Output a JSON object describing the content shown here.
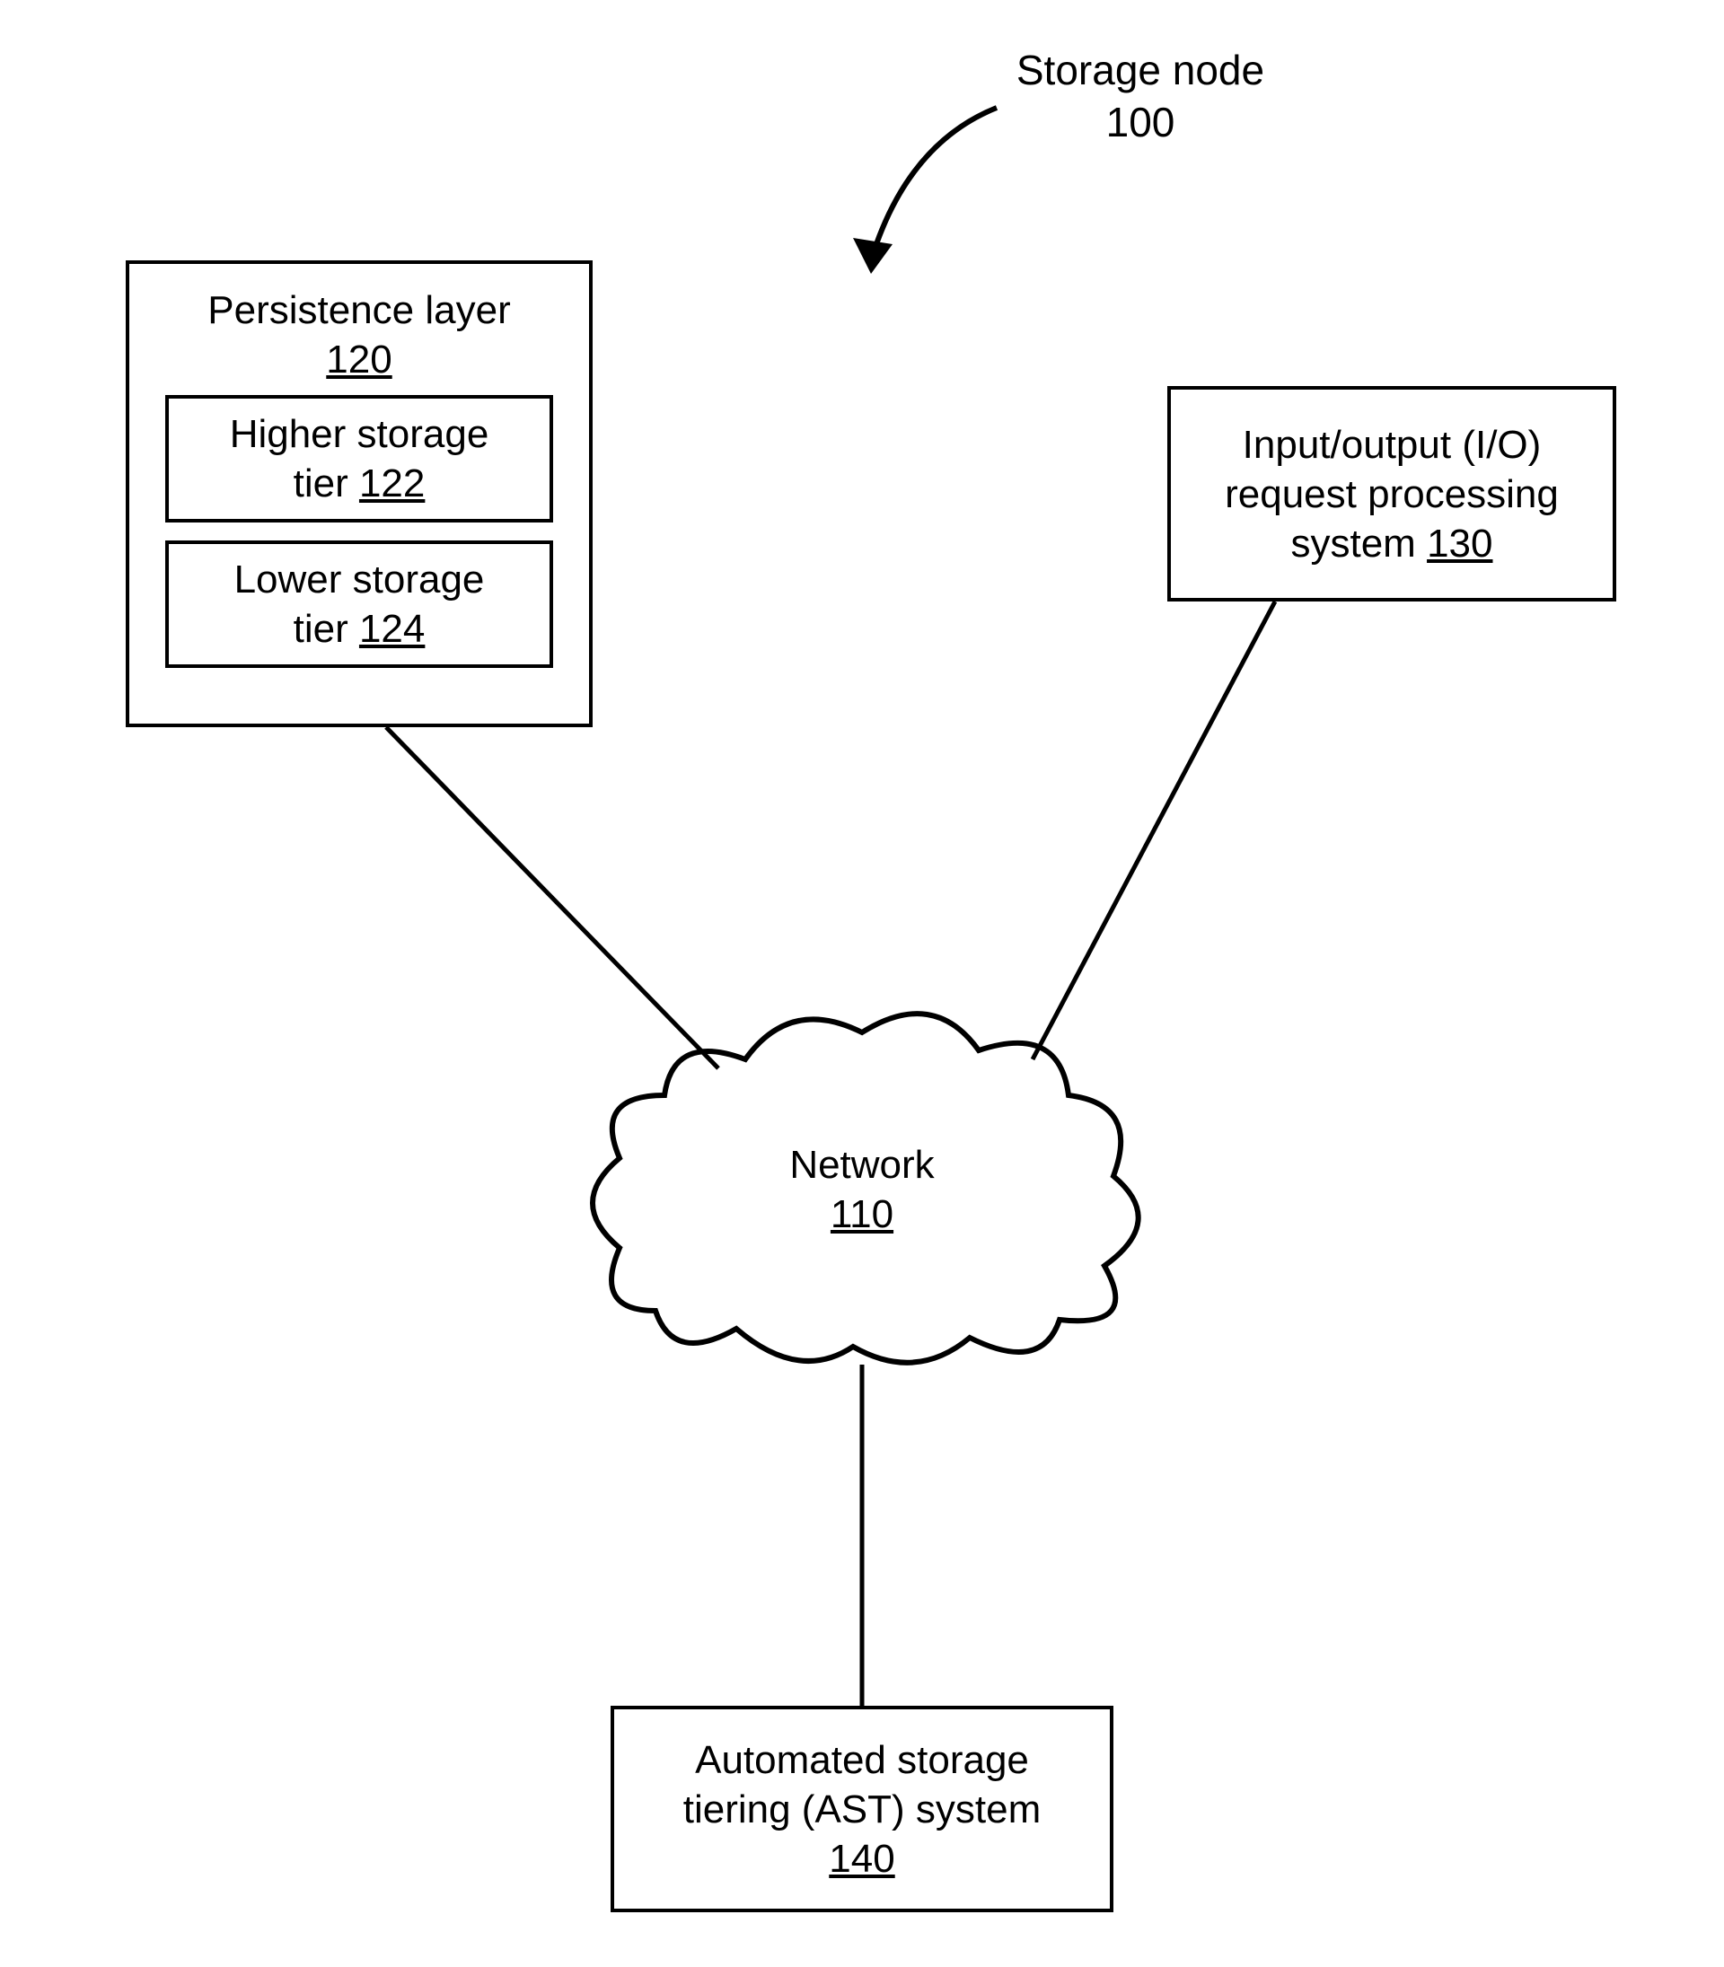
{
  "topLabel": {
    "line1": "Storage node",
    "ref": "100"
  },
  "persistence": {
    "title": "Persistence layer",
    "ref": "120",
    "higher": {
      "line1": "Higher storage",
      "line2": "tier ",
      "ref": "122"
    },
    "lower": {
      "line1": "Lower storage",
      "line2": "tier ",
      "ref": "124"
    }
  },
  "io": {
    "line1": "Input/output (I/O)",
    "line2": "request processing",
    "line3": "system ",
    "ref": "130"
  },
  "network": {
    "title": "Network",
    "ref": "110"
  },
  "ast": {
    "line1": "Automated storage",
    "line2": "tiering (AST) system",
    "ref": "140"
  }
}
